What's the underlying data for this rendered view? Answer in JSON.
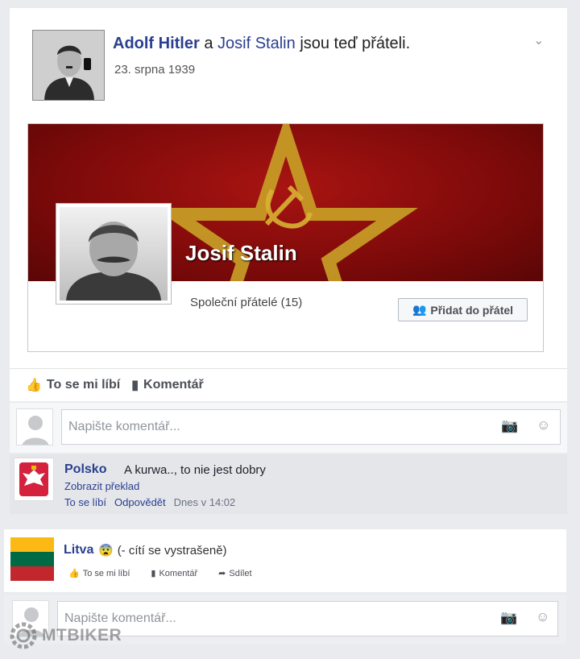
{
  "post": {
    "user1": "Adolf Hitler",
    "connector": "a",
    "user2": "Josif Stalin",
    "suffix": "jsou teď přáteli.",
    "date": "23. srpna 1939"
  },
  "profile": {
    "name": "Josif Stalin",
    "mutual_friends": "Společní přátelé (15)",
    "add_button": "Přidat do přátel"
  },
  "actions": {
    "like": "To se mi líbí",
    "comment": "Komentář"
  },
  "comment_box": {
    "placeholder": "Napište komentář..."
  },
  "comment1": {
    "author": "Polsko",
    "text": "A kurwa.., to nie jest dobry",
    "translate": "Zobrazit překlad",
    "like": "To se líbí",
    "reply": "Odpovědět",
    "time": "Dnes v 14:02"
  },
  "post2": {
    "author": "Litva",
    "feeling": "(- cítí se vystrašeně)",
    "like": "To se mi líbí",
    "comment": "Komentář",
    "share": "Sdílet"
  },
  "comment_box2": {
    "placeholder": "Napište komentář..."
  },
  "watermark": {
    "text": "MTBIKER"
  },
  "colors": {
    "link": "#2a3f8f",
    "cover_red": "#8e0e0e",
    "star_gold": "#c9a227"
  }
}
